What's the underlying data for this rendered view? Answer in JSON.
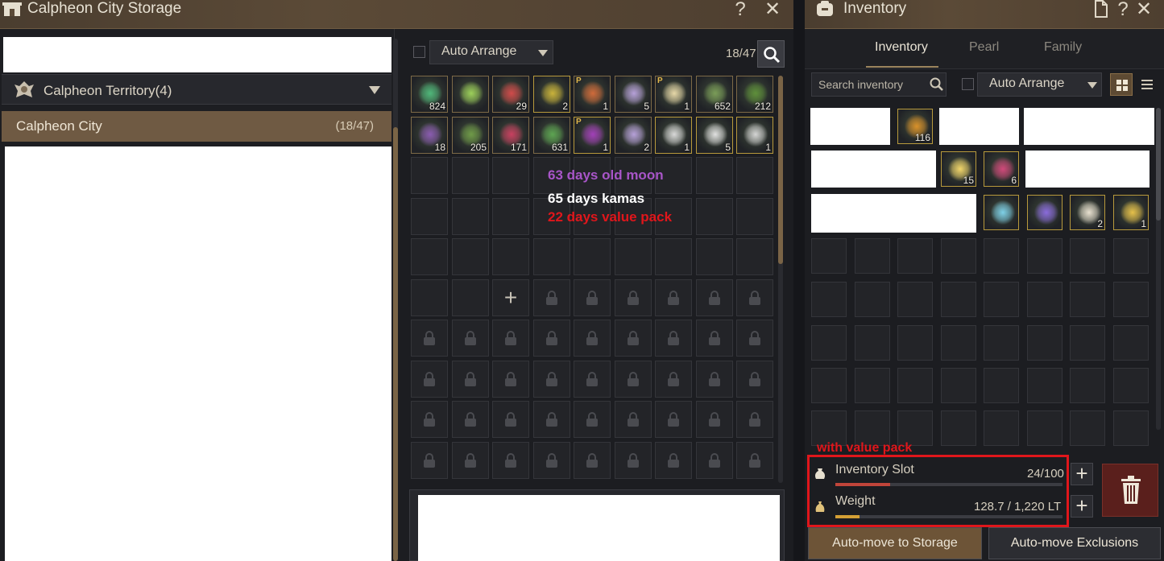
{
  "storage": {
    "title": "Calpheon City Storage",
    "help": "?",
    "close": "✕",
    "territory": "Calpheon Territory(4)",
    "city": "Calpheon City",
    "city_count": "(18/47)",
    "auto_arrange": "Auto Arrange",
    "slot_count": "18/47",
    "items": [
      {
        "qty": "824",
        "p": ""
      },
      {
        "qty": "",
        "p": ""
      },
      {
        "qty": "29",
        "p": ""
      },
      {
        "qty": "2",
        "p": ""
      },
      {
        "qty": "1",
        "p": "P"
      },
      {
        "qty": "5",
        "p": ""
      },
      {
        "qty": "1",
        "p": "P"
      },
      {
        "qty": "652",
        "p": ""
      },
      {
        "qty": "212",
        "p": ""
      },
      {
        "qty": "18",
        "p": ""
      },
      {
        "qty": "205",
        "p": ""
      },
      {
        "qty": "171",
        "p": ""
      },
      {
        "qty": "631",
        "p": ""
      },
      {
        "qty": "1",
        "p": "P"
      },
      {
        "qty": "2",
        "p": ""
      },
      {
        "qty": "1",
        "p": ""
      },
      {
        "qty": "5",
        "p": ""
      },
      {
        "qty": "1",
        "p": ""
      }
    ],
    "expand_plus": "+",
    "notes": {
      "moon": "63 days old moon",
      "kamas": "65 days kamas",
      "value_pack": "22 days value pack"
    }
  },
  "inventory": {
    "title": "Inventory",
    "help": "?",
    "close": "✕",
    "tabs": [
      "Inventory",
      "Pearl",
      "Family"
    ],
    "search_placeholder": "Search inventory",
    "auto_arrange": "Auto Arrange",
    "items": [
      {
        "qty": "116"
      },
      {
        "qty": "15"
      },
      {
        "qty": "6"
      },
      {
        "qty": ""
      },
      {
        "qty": ""
      },
      {
        "qty": "2"
      },
      {
        "qty": "1"
      }
    ],
    "value_pack_note": "with value pack",
    "slot_label": "Inventory Slot",
    "slot_value": "24/100",
    "slot_fill": 0.24,
    "weight_label": "Weight",
    "weight_value": "128.7 / 1,220 LT",
    "weight_fill": 0.105,
    "plus": "+",
    "auto_move_storage": "Auto-move to Storage",
    "auto_move_exclusions": "Auto-move Exclusions"
  },
  "colors": {
    "moon": "#a855c8",
    "kamas": "#ffffff",
    "value_pack": "#e0161b",
    "slot_bar": "#c0453a",
    "weight_bar": "#d4a035"
  }
}
